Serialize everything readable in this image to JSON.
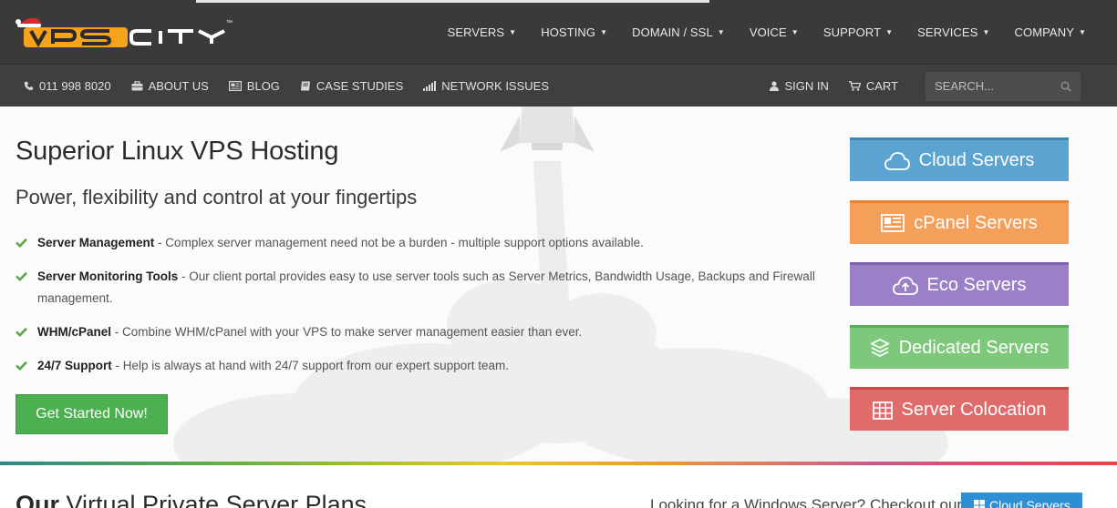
{
  "brand": {
    "logo_text": "VPSCITY",
    "trademark": "™"
  },
  "main_nav": [
    {
      "label": "SERVERS"
    },
    {
      "label": "HOSTING"
    },
    {
      "label": "DOMAIN / SSL"
    },
    {
      "label": "VOICE"
    },
    {
      "label": "SUPPORT"
    },
    {
      "label": "SERVICES"
    },
    {
      "label": "COMPANY"
    }
  ],
  "sub_nav": {
    "phone": "011 998 8020",
    "about": "ABOUT US",
    "blog": "BLOG",
    "case_studies": "CASE STUDIES",
    "network": "NETWORK ISSUES",
    "signin": "SIGN IN",
    "cart": "CART",
    "search_placeholder": "SEARCH..."
  },
  "hero": {
    "title": "Superior Linux VPS Hosting",
    "subtitle": "Power, flexibility and control at your fingertips",
    "features": [
      {
        "title": "Server Management",
        "text": " - Complex server management need not be a burden - multiple support options available."
      },
      {
        "title": "Server Monitoring Tools",
        "text": " - Our client portal provides easy to use server tools such as Server Metrics, Bandwidth Usage, Backups and Firewall management."
      },
      {
        "title": "WHM/cPanel",
        "text": " - Combine WHM/cPanel with your VPS to make server management easier than ever."
      },
      {
        "title": "24/7 Support",
        "text": " - Help is always at hand with 24/7 support from our expert support team."
      }
    ],
    "cta": "Get Started Now!"
  },
  "side_buttons": [
    {
      "label": "Cloud Servers",
      "icon": "cloud-icon",
      "color": "#5ba3d0"
    },
    {
      "label": "cPanel Servers",
      "icon": "cpanel-icon",
      "color": "#f5a05a"
    },
    {
      "label": "Eco Servers",
      "icon": "cloud-upload-icon",
      "color": "#9b7fc7"
    },
    {
      "label": "Dedicated Servers",
      "icon": "layers-icon",
      "color": "#7dc87a"
    },
    {
      "label": "Server Colocation",
      "icon": "grid-icon",
      "color": "#e06b6b"
    }
  ],
  "plans": {
    "title_bold": "Our",
    "title_rest": " Virtual Private Server Plans",
    "windows_note": "Looking for a Windows Server? Checkout our",
    "windows_button": "Cloud Servers"
  },
  "colors": {
    "topbar": "#3a3a3a",
    "subbar": "#3f3f3f",
    "cta_green": "#4caf50",
    "check_green": "#5aa84a",
    "windows_blue": "#2e8fd4"
  }
}
